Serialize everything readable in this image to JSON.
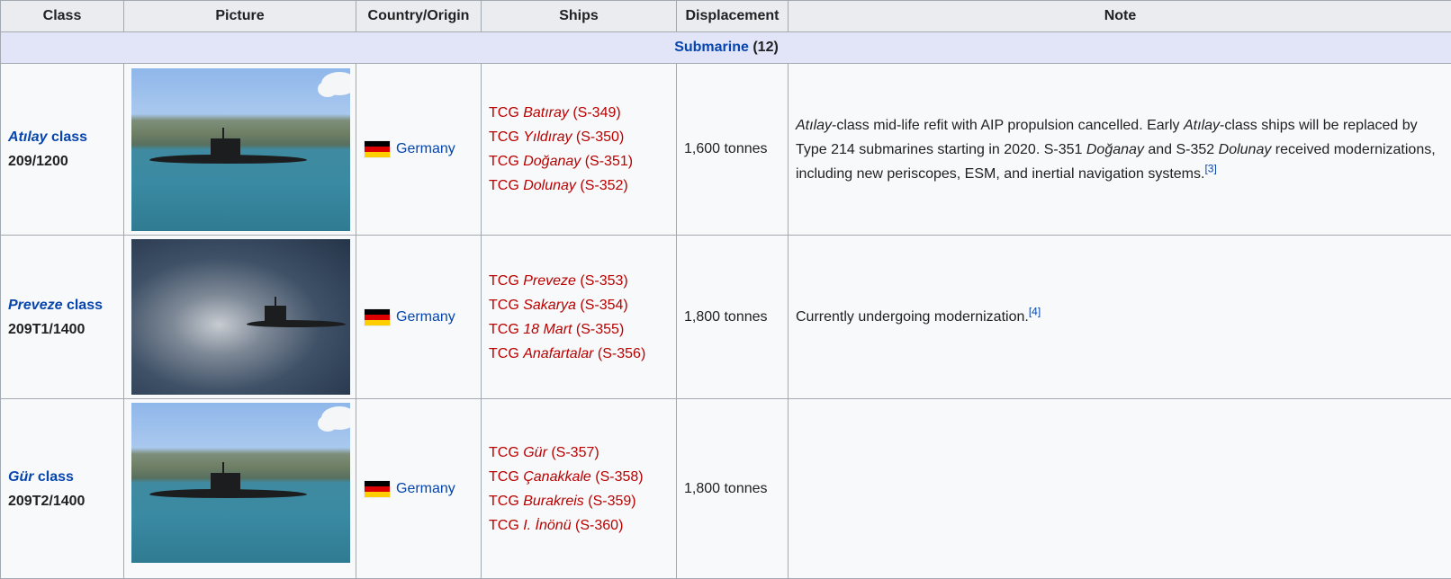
{
  "table": {
    "headers": [
      "Class",
      "Picture",
      "Country/Origin",
      "Ships",
      "Displacement",
      "Note"
    ],
    "section": {
      "label": "Submarine",
      "count": "(12)"
    },
    "rows": [
      {
        "class_name": "Atılay",
        "class_suffix": " class",
        "class_type": "209/1200",
        "picture": "Atılay-class submarine photo",
        "country": "Germany",
        "flag_icon": "germany-flag-icon",
        "ships": [
          {
            "prefix": "TCG ",
            "name": "Batıray",
            "pennant": " (S-349)"
          },
          {
            "prefix": "TCG ",
            "name": "Yıldıray",
            "pennant": " (S-350)"
          },
          {
            "prefix": "TCG ",
            "name": "Doğanay",
            "pennant": " (S-351)"
          },
          {
            "prefix": "TCG ",
            "name": "Dolunay",
            "pennant": " (S-352)"
          }
        ],
        "displacement": "1,600 tonnes",
        "note": {
          "p1_i": "Atılay",
          "p2": "-class mid-life refit with AIP propulsion cancelled. Early ",
          "p3_i": "Atılay",
          "p4": "-class ships will be replaced by Type 214 submarines starting in 2020. S-351 ",
          "p5_i": "Doğanay",
          "p6": " and S-352 ",
          "p7_i": "Dolunay",
          "p8": " received modernizations, including new periscopes, ESM, and inertial navigation systems.",
          "ref": "[3]"
        }
      },
      {
        "class_name": "Preveze",
        "class_suffix": " class",
        "class_type": "209T1/1400",
        "picture": "Preveze-class submarine photo",
        "country": "Germany",
        "flag_icon": "germany-flag-icon",
        "ships": [
          {
            "prefix": "TCG ",
            "name": "Preveze",
            "pennant": " (S-353)"
          },
          {
            "prefix": "TCG ",
            "name": "Sakarya",
            "pennant": " (S-354)"
          },
          {
            "prefix": "TCG ",
            "name": "18 Mart",
            "pennant": " (S-355)"
          },
          {
            "prefix": "TCG ",
            "name": "Anafartalar",
            "pennant": " (S-356)"
          }
        ],
        "displacement": "1,800 tonnes",
        "note": {
          "text": "Currently undergoing modernization.",
          "ref": "[4]"
        }
      },
      {
        "class_name": "Gür",
        "class_suffix": " class",
        "class_type": "209T2/1400",
        "picture": "Gür-class submarine photo",
        "country": "Germany",
        "flag_icon": "germany-flag-icon",
        "ships": [
          {
            "prefix": "TCG ",
            "name": "Gür",
            "pennant": " (S-357)"
          },
          {
            "prefix": "TCG ",
            "name": "Çanakkale",
            "pennant": " (S-358)"
          },
          {
            "prefix": "TCG ",
            "name": "Burakreis",
            "pennant": " (S-359)"
          },
          {
            "prefix": "TCG ",
            "name": "I. İnönü",
            "pennant": " (S-360)"
          }
        ],
        "displacement": "1,800 tonnes",
        "note": {
          "text": ""
        }
      }
    ]
  },
  "colors": {
    "link": "#0645ad",
    "redlink": "#ba0000",
    "header_bg": "#eaecf0",
    "section_bg": "#e2e4f8",
    "cell_bg": "#f8f9fa",
    "border": "#a2a9b1"
  }
}
